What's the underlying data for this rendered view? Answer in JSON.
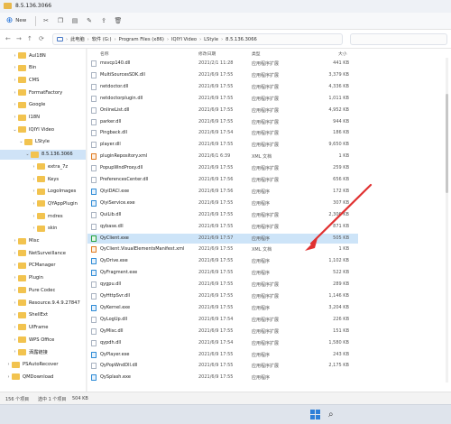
{
  "window": {
    "title": "8.5.136.3066"
  },
  "toolbar": {
    "new_label": "New",
    "icons": [
      "cut-icon",
      "copy-icon",
      "paste-icon",
      "rename-icon",
      "share-icon",
      "delete-icon"
    ]
  },
  "address": {
    "crumbs": [
      "此电脑",
      "软件 (G:)",
      "Program Files (x86)",
      "IQIYI Video",
      "LStyle",
      "8.5.136.3066"
    ]
  },
  "sidebar": {
    "items": [
      {
        "label": "Aul18N",
        "level": 1,
        "expanded": false
      },
      {
        "label": "Bin",
        "level": 1,
        "expanded": false
      },
      {
        "label": "CMS",
        "level": 1,
        "expanded": false
      },
      {
        "label": "FormatFactory",
        "level": 1,
        "expanded": false
      },
      {
        "label": "Google",
        "level": 1,
        "expanded": false
      },
      {
        "label": "I18N",
        "level": 1,
        "expanded": false
      },
      {
        "label": "IQIYI Video",
        "level": 1,
        "expanded": true
      },
      {
        "label": "LStyle",
        "level": 2,
        "expanded": true
      },
      {
        "label": "8.5.136.3066",
        "level": 3,
        "expanded": true,
        "selected": true
      },
      {
        "label": "extra_7z",
        "level": 4,
        "expanded": false
      },
      {
        "label": "Keys",
        "level": 4,
        "expanded": false
      },
      {
        "label": "LogoImages",
        "level": 4,
        "expanded": false
      },
      {
        "label": "QYAppPlugin",
        "level": 4,
        "expanded": false
      },
      {
        "label": "rndres",
        "level": 4,
        "expanded": false
      },
      {
        "label": "skin",
        "level": 4,
        "expanded": false
      },
      {
        "label": "Misc",
        "level": 1,
        "expanded": false
      },
      {
        "label": "NetSurveillance",
        "level": 1,
        "expanded": false
      },
      {
        "label": "PCManager",
        "level": 1,
        "expanded": false
      },
      {
        "label": "Plugin",
        "level": 1,
        "expanded": false
      },
      {
        "label": "Pure Codec",
        "level": 1,
        "expanded": false
      },
      {
        "label": "Resource.9.4.9.27847",
        "level": 1,
        "expanded": false
      },
      {
        "label": "ShellExt",
        "level": 1,
        "expanded": false
      },
      {
        "label": "UIFrame",
        "level": 1,
        "expanded": false
      },
      {
        "label": "WPS Office",
        "level": 1,
        "expanded": false
      },
      {
        "label": "洒露链接",
        "level": 1,
        "expanded": false
      },
      {
        "label": "PSAutoRecover",
        "level": 0,
        "expanded": false
      },
      {
        "label": "QMDownload",
        "level": 0,
        "expanded": false
      }
    ]
  },
  "columns": {
    "name": "名称",
    "date": "修改日期",
    "type": "类型",
    "size": "大小"
  },
  "files": [
    {
      "name": "msvcp140.dll",
      "date": "2021/2/1 11:28",
      "type": "应用程序扩展",
      "size": "441 KB",
      "icon": "dll"
    },
    {
      "name": "MultiSourcesSDK.dll",
      "date": "2021/6/9 17:55",
      "type": "应用程序扩展",
      "size": "3,379 KB",
      "icon": "dll"
    },
    {
      "name": "netdoctor.dll",
      "date": "2021/6/9 17:55",
      "type": "应用程序扩展",
      "size": "4,336 KB",
      "icon": "dll"
    },
    {
      "name": "netdoctorplugin.dll",
      "date": "2021/6/9 17:55",
      "type": "应用程序扩展",
      "size": "1,011 KB",
      "icon": "dll"
    },
    {
      "name": "OnlineList.dll",
      "date": "2021/6/9 17:55",
      "type": "应用程序扩展",
      "size": "4,952 KB",
      "icon": "dll"
    },
    {
      "name": "parker.dll",
      "date": "2021/6/9 17:55",
      "type": "应用程序扩展",
      "size": "944 KB",
      "icon": "dll"
    },
    {
      "name": "Pingback.dll",
      "date": "2021/6/9 17:54",
      "type": "应用程序扩展",
      "size": "186 KB",
      "icon": "dll"
    },
    {
      "name": "player.dll",
      "date": "2021/6/9 17:55",
      "type": "应用程序扩展",
      "size": "9,650 KB",
      "icon": "dll"
    },
    {
      "name": "pluginRepository.xml",
      "date": "2021/6/1 6:39",
      "type": "XML 文档",
      "size": "1 KB",
      "icon": "xml"
    },
    {
      "name": "PopupWndProxy.dll",
      "date": "2021/6/9 17:55",
      "type": "应用程序扩展",
      "size": "259 KB",
      "icon": "dll"
    },
    {
      "name": "PreferencesCenter.dll",
      "date": "2021/6/9 17:56",
      "type": "应用程序扩展",
      "size": "656 KB",
      "icon": "dll"
    },
    {
      "name": "QiyiDACl.exe",
      "date": "2021/6/9 17:56",
      "type": "应用程序",
      "size": "172 KB",
      "icon": "exe"
    },
    {
      "name": "QiyiService.exe",
      "date": "2021/6/9 17:55",
      "type": "应用程序",
      "size": "307 KB",
      "icon": "exe"
    },
    {
      "name": "QuiLib.dll",
      "date": "2021/6/9 17:55",
      "type": "应用程序扩展",
      "size": "2,306 KB",
      "icon": "dll"
    },
    {
      "name": "qybase.dll",
      "date": "2021/6/9 17:55",
      "type": "应用程序扩展",
      "size": "871 KB",
      "icon": "dll"
    },
    {
      "name": "QyClient.exe",
      "date": "2021/6/9 17:57",
      "type": "应用程序",
      "size": "505 KB",
      "icon": "exe-green",
      "selected": true
    },
    {
      "name": "QyClient.VisualElementsManifest.xml",
      "date": "2021/6/9 17:55",
      "type": "XML 文档",
      "size": "1 KB",
      "icon": "xml"
    },
    {
      "name": "QyDrive.exe",
      "date": "2021/6/9 17:55",
      "type": "应用程序",
      "size": "1,102 KB",
      "icon": "exe"
    },
    {
      "name": "QyFragment.exe",
      "date": "2021/6/9 17:55",
      "type": "应用程序",
      "size": "522 KB",
      "icon": "exe"
    },
    {
      "name": "qygpu.dll",
      "date": "2021/6/9 17:55",
      "type": "应用程序扩展",
      "size": "289 KB",
      "icon": "dll"
    },
    {
      "name": "QyHttpSvr.dll",
      "date": "2021/6/9 17:55",
      "type": "应用程序扩展",
      "size": "1,146 KB",
      "icon": "dll"
    },
    {
      "name": "QyKernel.exe",
      "date": "2021/6/9 17:55",
      "type": "应用程序",
      "size": "3,204 KB",
      "icon": "exe"
    },
    {
      "name": "QyLogUp.dll",
      "date": "2021/6/9 17:54",
      "type": "应用程序扩展",
      "size": "226 KB",
      "icon": "dll"
    },
    {
      "name": "QyMisc.dll",
      "date": "2021/6/9 17:55",
      "type": "应用程序扩展",
      "size": "151 KB",
      "icon": "dll"
    },
    {
      "name": "qypdh.dll",
      "date": "2021/6/9 17:54",
      "type": "应用程序扩展",
      "size": "1,580 KB",
      "icon": "dll"
    },
    {
      "name": "QyPlayer.exe",
      "date": "2021/6/9 17:55",
      "type": "应用程序",
      "size": "243 KB",
      "icon": "exe"
    },
    {
      "name": "QyPopWndDll.dll",
      "date": "2021/6/9 17:55",
      "type": "应用程序扩展",
      "size": "2,175 KB",
      "icon": "dll"
    },
    {
      "name": "QySplash.exe",
      "date": "2021/6/9 17:55",
      "type": "应用程序",
      "size": "",
      "icon": "exe"
    }
  ],
  "status": {
    "count": "156 个项目",
    "selection": "选中 1 个项目",
    "size": "504 KB"
  },
  "annotation": {
    "color": "#e03131"
  }
}
